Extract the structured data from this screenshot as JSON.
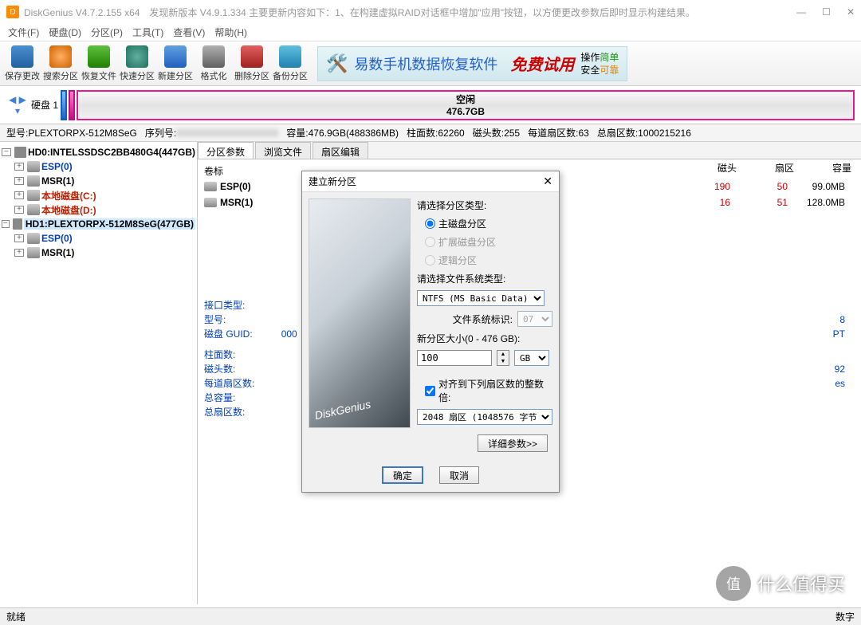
{
  "title": "DiskGenius V4.7.2.155 x64　发现新版本 V4.9.1.334 主要更新内容如下：1、在构建虚拟RAID对话框中增加\"应用\"按钮，以方便更改参数后即时显示构建结果。",
  "menu": [
    "文件(F)",
    "硬盘(D)",
    "分区(P)",
    "工具(T)",
    "查看(V)",
    "帮助(H)"
  ],
  "tools": [
    "保存更改",
    "搜索分区",
    "恢复文件",
    "快速分区",
    "新建分区",
    "格式化",
    "删除分区",
    "备份分区"
  ],
  "banner": {
    "t1": "易数手机数据恢复软件",
    "t2": "免费试用",
    "l1a": "操作",
    "l1b": "简单",
    "l2a": "安全",
    "l2b": "可靠"
  },
  "disk_label": "硬盘 1",
  "free_seg": {
    "name": "空闲",
    "size": "476.7GB"
  },
  "infoline": {
    "model_k": "型号:",
    "model_v": "PLEXTORPX-512M8SeG",
    "serial_k": "序列号:",
    "cap_k": "容量:",
    "cap_v": "476.9GB(488386MB)",
    "cyl_k": "柱面数:",
    "cyl_v": "62260",
    "head_k": "磁头数:",
    "head_v": "255",
    "spt_k": "每道扇区数:",
    "spt_v": "63",
    "tot_k": "总扇区数:",
    "tot_v": "1000215216"
  },
  "tree": {
    "d0": {
      "label": "HD0:INTELSSDSC2BB480G4(447GB)",
      "items": [
        {
          "txt": "ESP(0)",
          "cls": "t-blue",
          "exp": "+"
        },
        {
          "txt": "MSR(1)",
          "cls": "t-black",
          "exp": "+"
        },
        {
          "txt": "本地磁盘(C:)",
          "cls": "t-red",
          "exp": "+"
        },
        {
          "txt": "本地磁盘(D:)",
          "cls": "t-red",
          "exp": "+"
        }
      ]
    },
    "d1": {
      "label": "HD1:PLEXTORPX-512M8SeG(477GB)",
      "items": [
        {
          "txt": "ESP(0)",
          "cls": "t-blue",
          "exp": "+"
        },
        {
          "txt": "MSR(1)",
          "cls": "t-black",
          "exp": "+"
        }
      ]
    }
  },
  "tabs": [
    "分区参数",
    "浏览文件",
    "扇区编辑"
  ],
  "cols": [
    "磁头",
    "扇区",
    "容量"
  ],
  "list": [
    {
      "name": "卷标",
      "vals": [
        "",
        "",
        ""
      ]
    },
    {
      "name": "ESP(0)",
      "vals": [
        "190",
        "50",
        "99.0MB"
      ],
      "red": 2
    },
    {
      "name": "MSR(1)",
      "vals": [
        "16",
        "51",
        "128.0MB"
      ],
      "red": 2
    }
  ],
  "info": {
    "k1": "接口类型:",
    "v1": "",
    "k2": "型号:",
    "v2": "8",
    "k3": "磁盘 GUID:",
    "v3": "000",
    "v3b": "PT",
    "k4": "柱面数:",
    "v4": "",
    "k5": "磁头数:",
    "v5": "92",
    "k6": "每道扇区数:",
    "v6": "es",
    "k7": "总容量:",
    "v7": "",
    "k8": "总扇区数:",
    "v8": ""
  },
  "modal": {
    "title": "建立新分区",
    "g1": "请选择分区类型:",
    "r1": "主磁盘分区",
    "r2": "扩展磁盘分区",
    "r3": "逻辑分区",
    "g2": "请选择文件系统类型:",
    "fs": "NTFS (MS Basic Data)",
    "fsid_l": "文件系统标识:",
    "fsid_v": "07",
    "g3": "新分区大小(0 - 476 GB):",
    "size": "100",
    "unit": "GB",
    "align": "对齐到下列扇区数的整数倍:",
    "align_v": "2048 扇区 (1048576 字节)",
    "detail": "详细参数>>",
    "ok": "确定",
    "cancel": "取消"
  },
  "status": {
    "l": "就绪",
    "r": "数字"
  },
  "wm": {
    "c": "值",
    "t": "什么值得买"
  }
}
